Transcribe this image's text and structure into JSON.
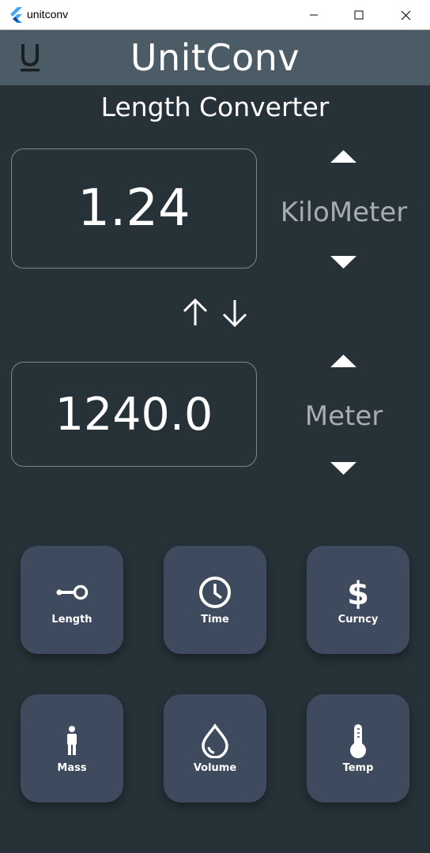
{
  "window": {
    "title": "unitconv"
  },
  "appbar": {
    "title": "UnitConv",
    "logo_letter": "U"
  },
  "converter": {
    "title": "Length Converter",
    "top": {
      "value": "1.24",
      "unit": "KiloMeter"
    },
    "bottom": {
      "value": "1240.0",
      "unit": "Meter"
    }
  },
  "categories": [
    {
      "label": "Length",
      "icon": "length-icon"
    },
    {
      "label": "Time",
      "icon": "clock-icon"
    },
    {
      "label": "Curncy",
      "icon": "dollar-icon"
    },
    {
      "label": "Mass",
      "icon": "person-icon"
    },
    {
      "label": "Volume",
      "icon": "water-drop-icon"
    },
    {
      "label": "Temp",
      "icon": "thermometer-icon"
    }
  ],
  "colors": {
    "background": "#263238",
    "appbar": "#4b5c66",
    "card": "#3e4a5e",
    "unit_text": "#a8adb0"
  }
}
